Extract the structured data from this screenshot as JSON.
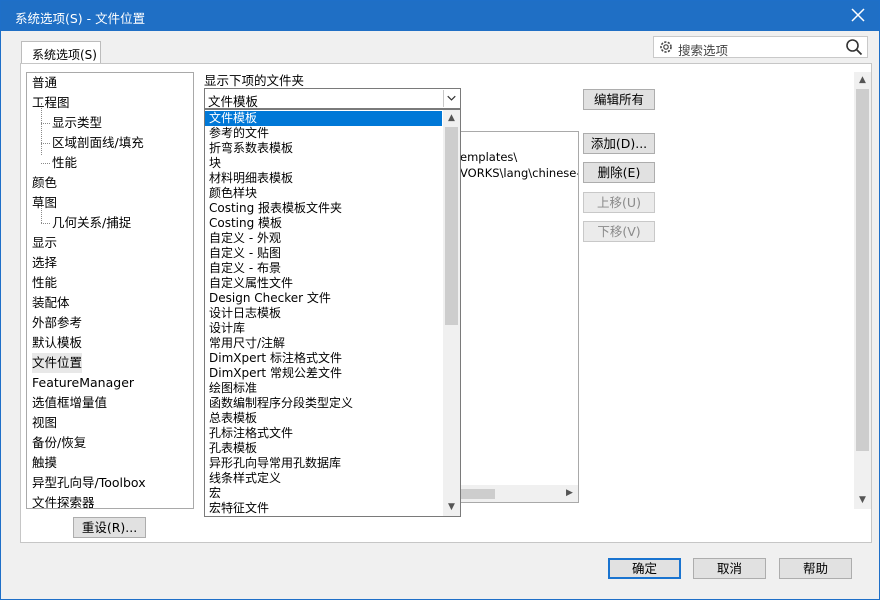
{
  "window": {
    "title": "系统选项(S) - 文件位置",
    "close_glyph": "✕"
  },
  "tab": {
    "label": "系统选项(S)"
  },
  "search": {
    "placeholder": "搜索选项"
  },
  "nav": {
    "items": [
      {
        "label": "普通",
        "sub": false
      },
      {
        "label": "工程图",
        "sub": false
      },
      {
        "label": "显示类型",
        "sub": true
      },
      {
        "label": "区域剖面线/填充",
        "sub": true
      },
      {
        "label": "性能",
        "sub": true
      },
      {
        "label": "颜色",
        "sub": false
      },
      {
        "label": "草图",
        "sub": false
      },
      {
        "label": "几何关系/捕捉",
        "sub": true
      },
      {
        "label": "显示",
        "sub": false
      },
      {
        "label": "选择",
        "sub": false
      },
      {
        "label": "性能",
        "sub": false
      },
      {
        "label": "装配体",
        "sub": false
      },
      {
        "label": "外部参考",
        "sub": false
      },
      {
        "label": "默认模板",
        "sub": false
      },
      {
        "label": "文件位置",
        "sub": false,
        "selected": true
      },
      {
        "label": "FeatureManager",
        "sub": false
      },
      {
        "label": "选值框增量值",
        "sub": false
      },
      {
        "label": "视图",
        "sub": false
      },
      {
        "label": "备份/恢复",
        "sub": false
      },
      {
        "label": "触摸",
        "sub": false
      },
      {
        "label": "异型孔向导/Toolbox",
        "sub": false
      },
      {
        "label": "文件探索器",
        "sub": false
      }
    ]
  },
  "main": {
    "show_label": "显示下项的文件夹",
    "combo_value": "文件模板",
    "folder_paths": [
      "emplates\\",
      "VORKS\\lang\\chinese-si"
    ]
  },
  "dropdown": {
    "options": [
      "文件模板",
      "参考的文件",
      "折弯系数表模板",
      "块",
      "材料明细表模板",
      "颜色样块",
      "Costing 报表模板文件夹",
      "Costing 模板",
      "自定义 - 外观",
      "自定义 - 贴图",
      "自定义 - 布景",
      "自定义属性文件",
      "Design Checker 文件",
      "设计日志模板",
      "设计库",
      "常用尺寸/注解",
      "DimXpert 标注格式文件",
      "DimXpert 常规公差文件",
      "绘图标准",
      "函数编制程序分段类型定义",
      "总表模板",
      "孔标注格式文件",
      "孔表模板",
      "异形孔向导常用孔数据库",
      "线条样式定义",
      "宏",
      "宏特征文件"
    ],
    "highlighted_index": 0
  },
  "buttons": {
    "edit_all": "编辑所有",
    "add": "添加(D)...",
    "delete": "删除(E)",
    "move_up": "上移(U)",
    "move_down": "下移(V)",
    "reset": "重设(R)...",
    "ok": "确定",
    "cancel": "取消",
    "help": "帮助"
  },
  "colors": {
    "accent": "#1f6fc5",
    "highlight": "#0078d7"
  }
}
